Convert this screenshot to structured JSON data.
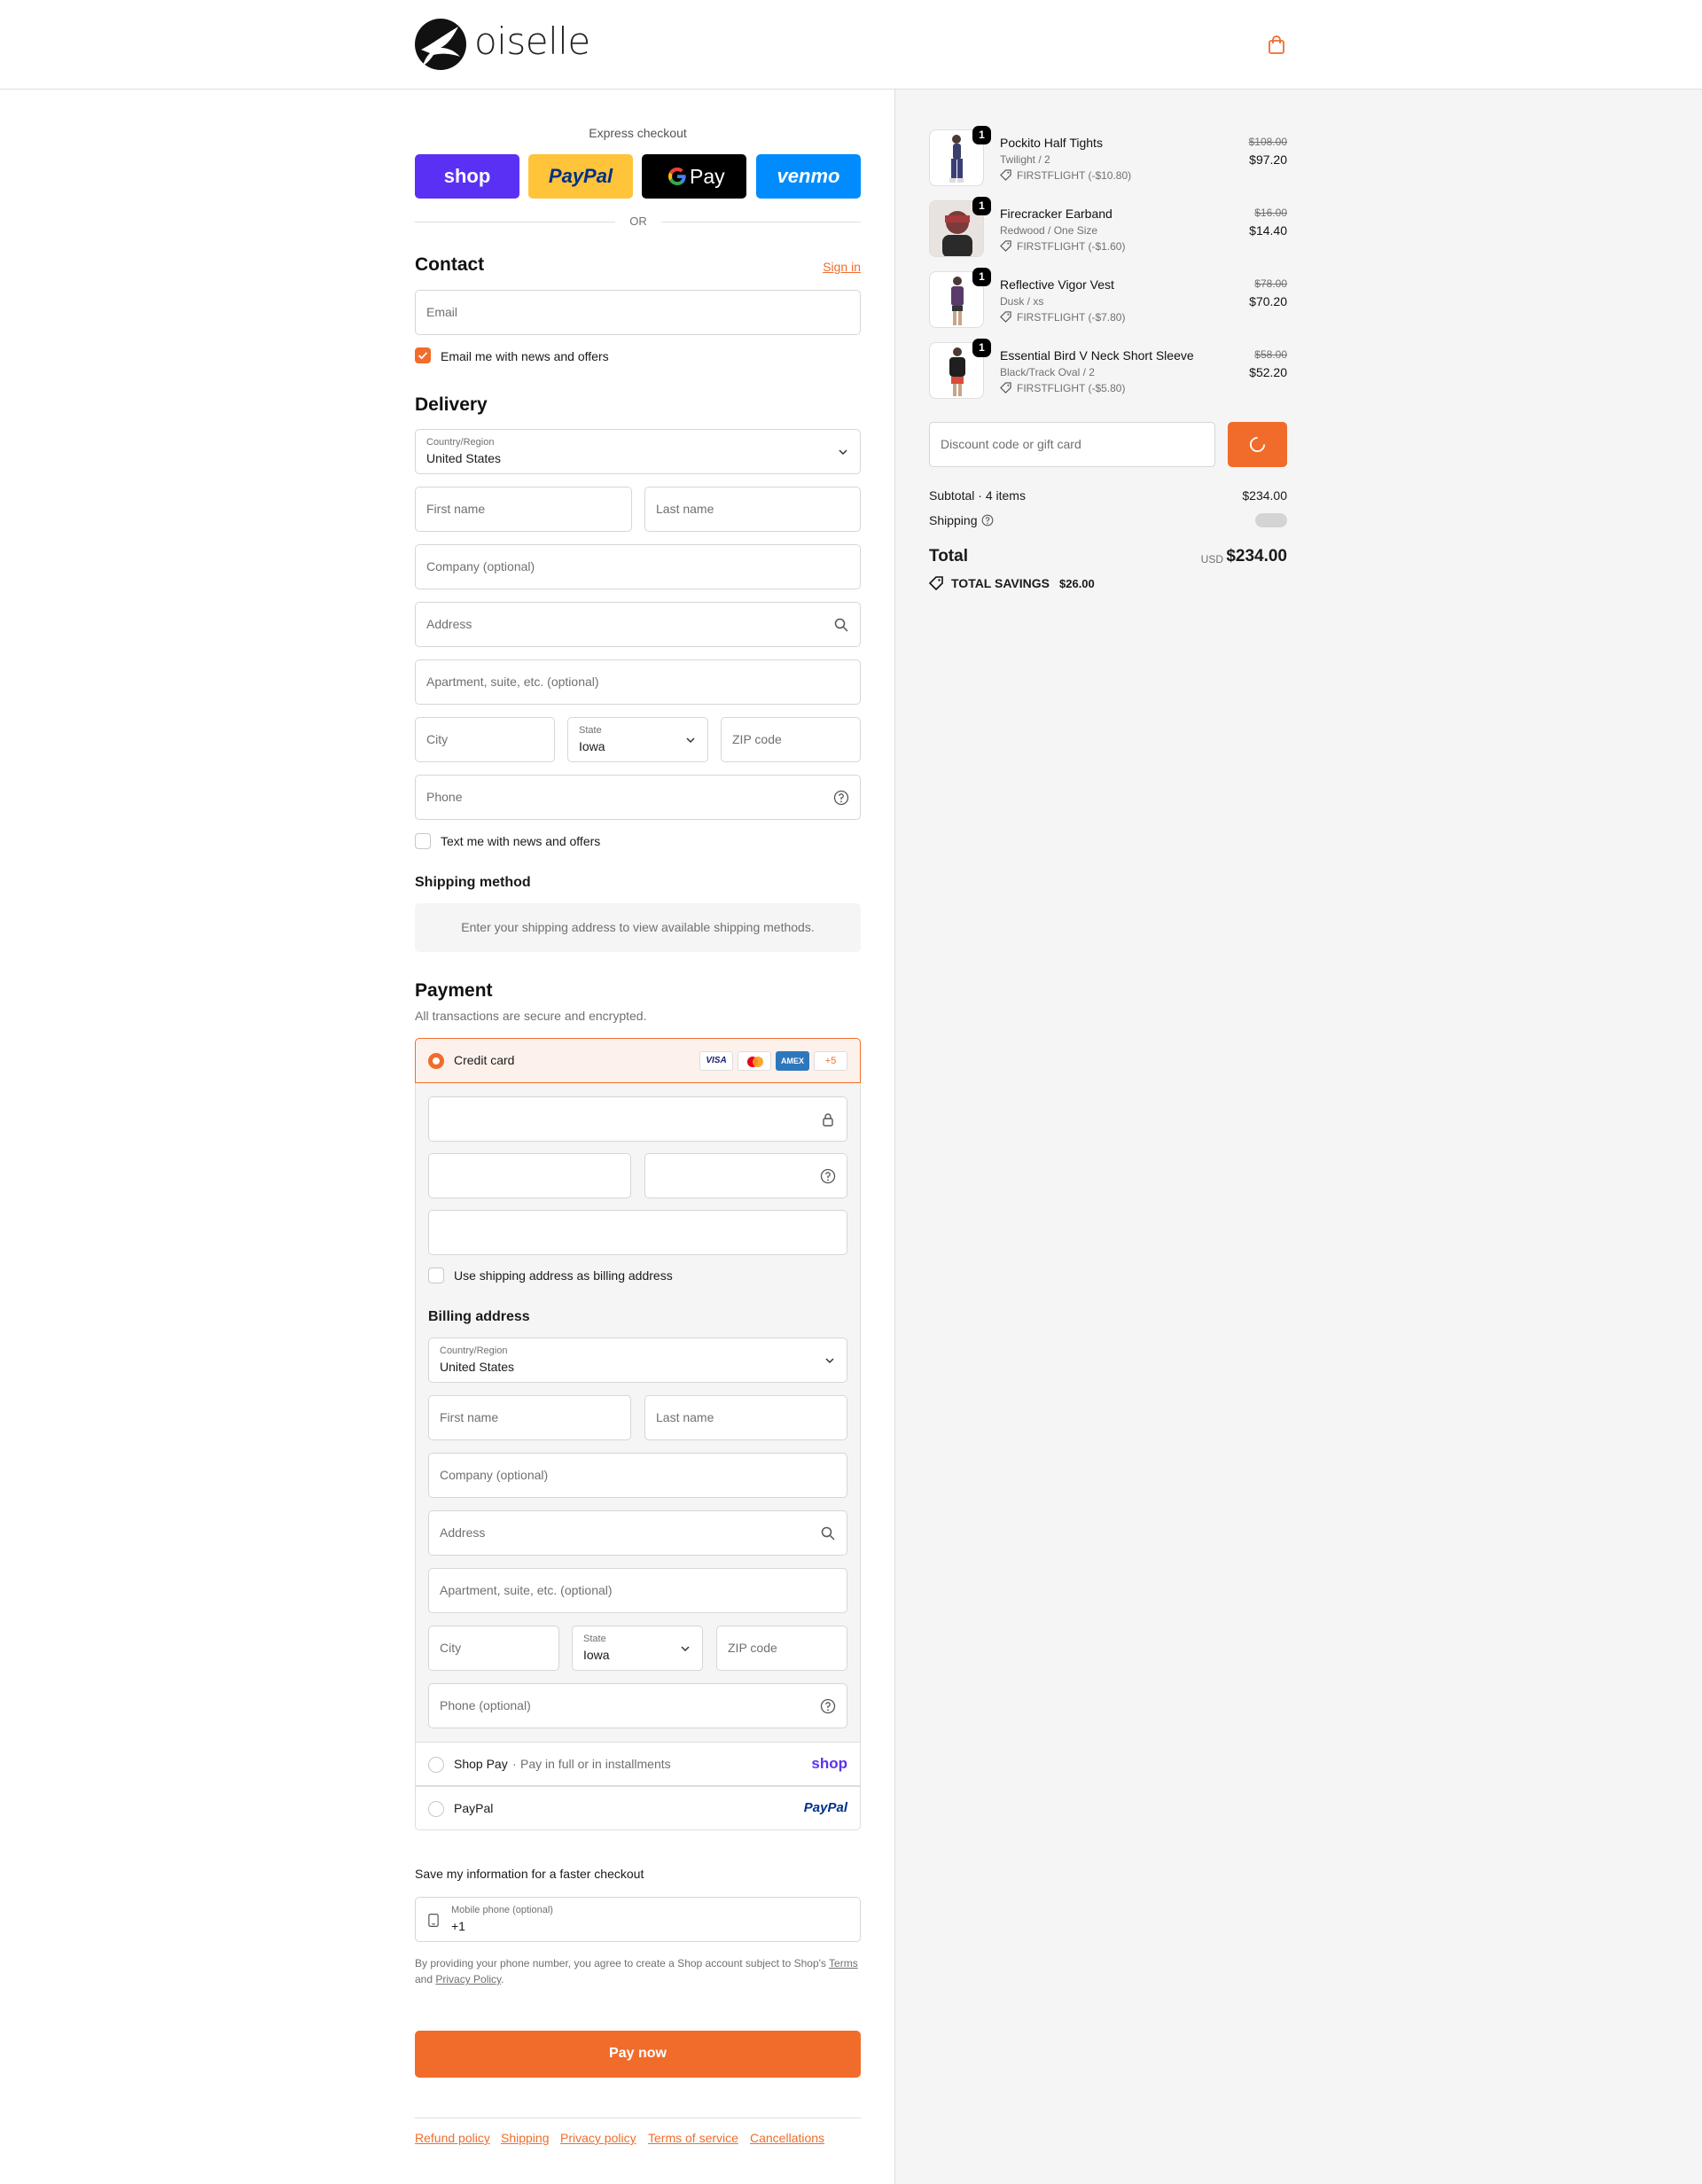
{
  "brand": {
    "logo_text": "oiselle",
    "accent_color": "#f16c2b"
  },
  "express": {
    "title": "Express checkout",
    "or_label": "OR",
    "shop_label": "shop",
    "paypal_label": "PayPal",
    "gpay_label": "Pay",
    "venmo_label": "venmo"
  },
  "contact": {
    "heading": "Contact",
    "sign_in": "Sign in",
    "email_placeholder": "Email",
    "news_checkbox_label": "Email me with news and offers",
    "news_checked": true
  },
  "delivery": {
    "heading": "Delivery",
    "country_label": "Country/Region",
    "country_value": "United States",
    "first_name": "First name",
    "last_name": "Last name",
    "company": "Company (optional)",
    "address": "Address",
    "apartment": "Apartment, suite, etc. (optional)",
    "city": "City",
    "state_label": "State",
    "state_value": "Iowa",
    "zip": "ZIP code",
    "phone": "Phone",
    "text_checkbox_label": "Text me with news and offers"
  },
  "shipping_method": {
    "heading": "Shipping method",
    "message": "Enter your shipping address to view available shipping methods."
  },
  "payment": {
    "heading": "Payment",
    "subtitle": "All transactions are secure and encrypted.",
    "credit_card_label": "Credit card",
    "card_brands": [
      "VISA",
      "mastercard",
      "AMEX",
      "+5"
    ],
    "use_shipping_label": "Use shipping address as billing address",
    "billing_heading": "Billing address",
    "billing": {
      "country_label": "Country/Region",
      "country_value": "United States",
      "first_name": "First name",
      "last_name": "Last name",
      "company": "Company (optional)",
      "address": "Address",
      "apartment": "Apartment, suite, etc. (optional)",
      "city": "City",
      "state_label": "State",
      "state_value": "Iowa",
      "zip": "ZIP code",
      "phone": "Phone (optional)"
    },
    "shop_pay_label": "Shop Pay",
    "shop_pay_sub": "Pay in full or in installments",
    "shop_pay_logo": "shop",
    "paypal_label": "PayPal",
    "paypal_logo": "PayPal"
  },
  "save_info": {
    "heading": "Save my information for a faster checkout",
    "mobile_label": "Mobile phone (optional)",
    "mobile_value": "+1",
    "disclaimer_pre": "By providing your phone number, you agree to create a Shop account subject to Shop's",
    "terms_link": "Terms",
    "disclaimer_and": "and",
    "privacy_link": "Privacy Policy",
    "disclaimer_end": "."
  },
  "pay_now_label": "Pay now",
  "footer_links": [
    "Refund policy",
    "Shipping",
    "Privacy policy",
    "Terms of service",
    "Cancellations"
  ],
  "summary": {
    "items": [
      {
        "qty": "1",
        "name": "Pockito Half Tights",
        "variant": "Twilight / 2",
        "discount": "FIRSTFLIGHT (-$10.80)",
        "original": "$108.00",
        "price": "$97.20"
      },
      {
        "qty": "1",
        "name": "Firecracker Earband",
        "variant": "Redwood / One Size",
        "discount": "FIRSTFLIGHT (-$1.60)",
        "original": "$16.00",
        "price": "$14.40"
      },
      {
        "qty": "1",
        "name": "Reflective Vigor Vest",
        "variant": "Dusk / xs",
        "discount": "FIRSTFLIGHT (-$7.80)",
        "original": "$78.00",
        "price": "$70.20"
      },
      {
        "qty": "1",
        "name": "Essential Bird V Neck Short Sleeve",
        "variant": "Black/Track Oval / 2",
        "discount": "FIRSTFLIGHT (-$5.80)",
        "original": "$58.00",
        "price": "$52.20"
      }
    ],
    "discount_placeholder": "Discount code or gift card",
    "subtotal_label": "Subtotal · 4 items",
    "subtotal_value": "$234.00",
    "shipping_label": "Shipping",
    "total_label": "Total",
    "currency": "USD",
    "total_value": "$234.00",
    "savings_label": "TOTAL SAVINGS",
    "savings_value": "$26.00"
  }
}
